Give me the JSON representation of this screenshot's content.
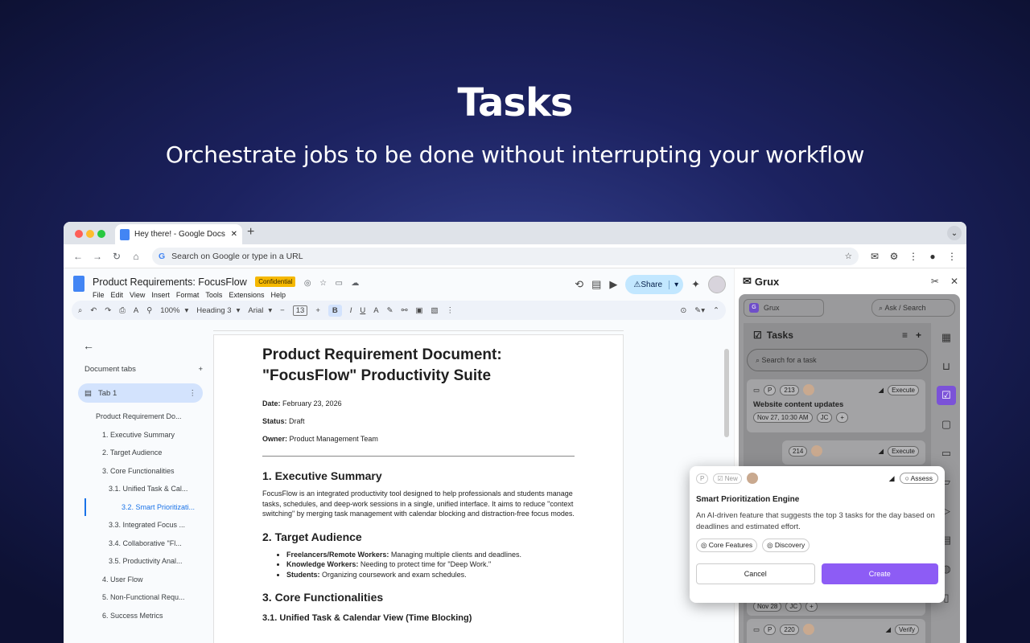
{
  "hero": {
    "title": "Tasks",
    "subtitle": "Orchestrate jobs to be done without interrupting your workflow"
  },
  "browser": {
    "tab_title": "Hey there! - Google Docs",
    "omnibox_placeholder": "Search on Google or type in a URL"
  },
  "docs": {
    "title": "Product Requirements: FocusFlow",
    "badge": "Confidential",
    "menu": [
      "File",
      "Edit",
      "View",
      "Insert",
      "Format",
      "Tools",
      "Extensions",
      "Help"
    ],
    "share_label": "Share",
    "zoom": "100%",
    "style": "Heading 3",
    "font": "Arial",
    "font_size": "13",
    "sidebar": {
      "heading": "Document tabs",
      "tab_name": "Tab 1",
      "outline": [
        "Product Requirement Do...",
        "1. Executive Summary",
        "2. Target Audience",
        "3. Core Functionalities",
        "3.1. Unified Task & Cal...",
        "3.2. Smart Prioritizati...",
        "3.3. Integrated Focus ...",
        "3.4. Collaborative \"Fl...",
        "3.5. Productivity Anal...",
        "4. User Flow",
        "5. Non-Functional Requ...",
        "6. Success Metrics"
      ]
    },
    "page": {
      "h1_line1": "Product Requirement Document:",
      "h1_line2": "\"FocusFlow\" Productivity Suite",
      "date_label": "Date:",
      "date_value": "February 23, 2026",
      "status_label": "Status:",
      "status_value": "Draft",
      "owner_label": "Owner:",
      "owner_value": "Product Management Team",
      "s1_title": "1. Executive Summary",
      "s1_body": "FocusFlow is an integrated productivity tool designed to help professionals and students manage tasks, schedules, and deep-work sessions in a single, unified interface. It aims to reduce \"context switching\" by merging task management with calendar blocking and distraction-free focus modes.",
      "s2_title": "2. Target Audience",
      "bullets": [
        {
          "b": "Freelancers/Remote Workers:",
          "t": " Managing multiple clients and deadlines."
        },
        {
          "b": "Knowledge Workers:",
          "t": " Needing to protect time for \"Deep Work.\""
        },
        {
          "b": "Students:",
          "t": " Organizing coursework and exam schedules."
        }
      ],
      "s3_title": "3. Core Functionalities",
      "s31_title": "3.1. Unified Task & Calendar View (Time Blocking)"
    }
  },
  "grux": {
    "brand": "Grux",
    "workspace": "Grux",
    "ask_placeholder": "Ask / Search",
    "tasks_title": "Tasks",
    "search_placeholder": "Search for a task",
    "cards": [
      {
        "id": "213",
        "status": "Execute",
        "title": "Website content updates",
        "date": "Nov 27, 10:30 AM",
        "assignee": "JC"
      },
      {
        "id": "214",
        "status": "Execute",
        "title": "",
        "date": "",
        "assignee": ""
      },
      {
        "id": "",
        "status": "",
        "title": "",
        "date": "Nov 28",
        "assignee": "JC"
      },
      {
        "id": "220",
        "status": "Verify",
        "title": "",
        "date": "",
        "assignee": ""
      }
    ],
    "popup": {
      "p_label": "P",
      "state": "New",
      "status": "Assess",
      "title": "Smart Prioritization Engine",
      "description": "An AI-driven feature that suggests the top 3 tasks for the day based on deadlines and estimated effort.",
      "tags": [
        "Core Features",
        "Discovery"
      ],
      "cancel": "Cancel",
      "create": "Create"
    }
  },
  "colors": {
    "accent": "#8d5cf5",
    "badge": "#f5b800",
    "share": "#c2e7ff"
  }
}
